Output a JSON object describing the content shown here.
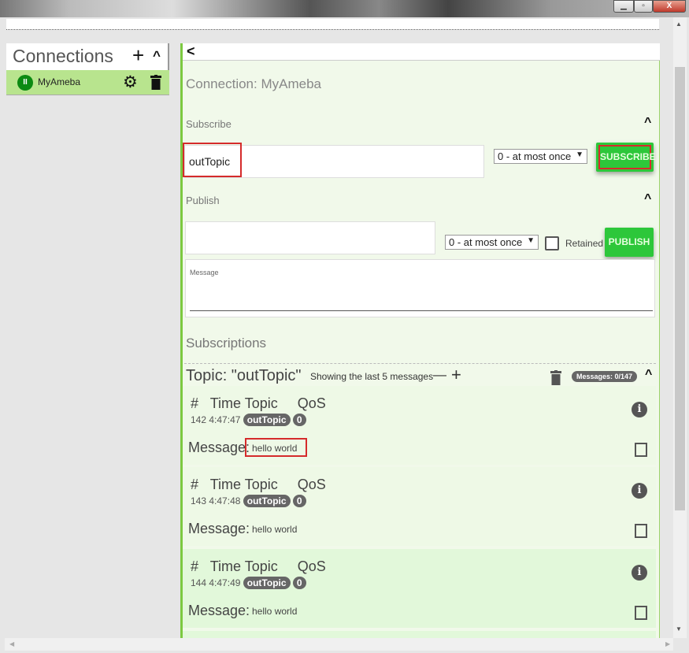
{
  "window": {
    "minimize_icon": "minimize-icon",
    "maximize_icon": "maximize-icon",
    "close_label": "X"
  },
  "sidebar": {
    "title": "Connections",
    "add_label": "+",
    "collapse_label": "^",
    "connections": [
      {
        "name": "MyAmeba",
        "status": "connected",
        "status_color": "#0b8a12"
      }
    ]
  },
  "main": {
    "back_label": "<",
    "connection_title": "Connection: MyAmeba",
    "subscribe": {
      "section_label": "Subscribe",
      "topic_value": "outTopic",
      "qos": "0 - at most once",
      "button": "SUBSCRIBE"
    },
    "publish": {
      "section_label": "Publish",
      "topic_value": "",
      "qos": "0 - at most once",
      "retained_label": "Retained",
      "retained": false,
      "button": "PUBLISH",
      "message_placeholder": "Message",
      "message_value": ""
    },
    "subscriptions_label": "Subscriptions",
    "topic": {
      "title": "Topic: \"outTopic\"",
      "showing": "Showing the last 5 messages",
      "minus": "—",
      "plus": "+",
      "messages_badge": "Messages: 0/147"
    },
    "messages": [
      {
        "header_hash": "#",
        "header_time": "Time",
        "header_topic": "Topic",
        "header_qos": "QoS",
        "num": "142",
        "time": "4:47:47",
        "topic": "outTopic",
        "qos": "0",
        "message_label": "Message:",
        "message": "hello world"
      },
      {
        "header_hash": "#",
        "header_time": "Time",
        "header_topic": "Topic",
        "header_qos": "QoS",
        "num": "143",
        "time": "4:47:48",
        "topic": "outTopic",
        "qos": "0",
        "message_label": "Message:",
        "message": "hello world"
      },
      {
        "header_hash": "#",
        "header_time": "Time",
        "header_topic": "Topic",
        "header_qos": "QoS",
        "num": "144",
        "time": "4:47:49",
        "topic": "outTopic",
        "qos": "0",
        "message_label": "Message:",
        "message": "hello world"
      }
    ]
  },
  "colors": {
    "accent_green": "#2dc73a",
    "panel_bg": "#f1f9ea",
    "highlight_red": "#d52b2b",
    "connection_bg": "#b8e48e"
  }
}
